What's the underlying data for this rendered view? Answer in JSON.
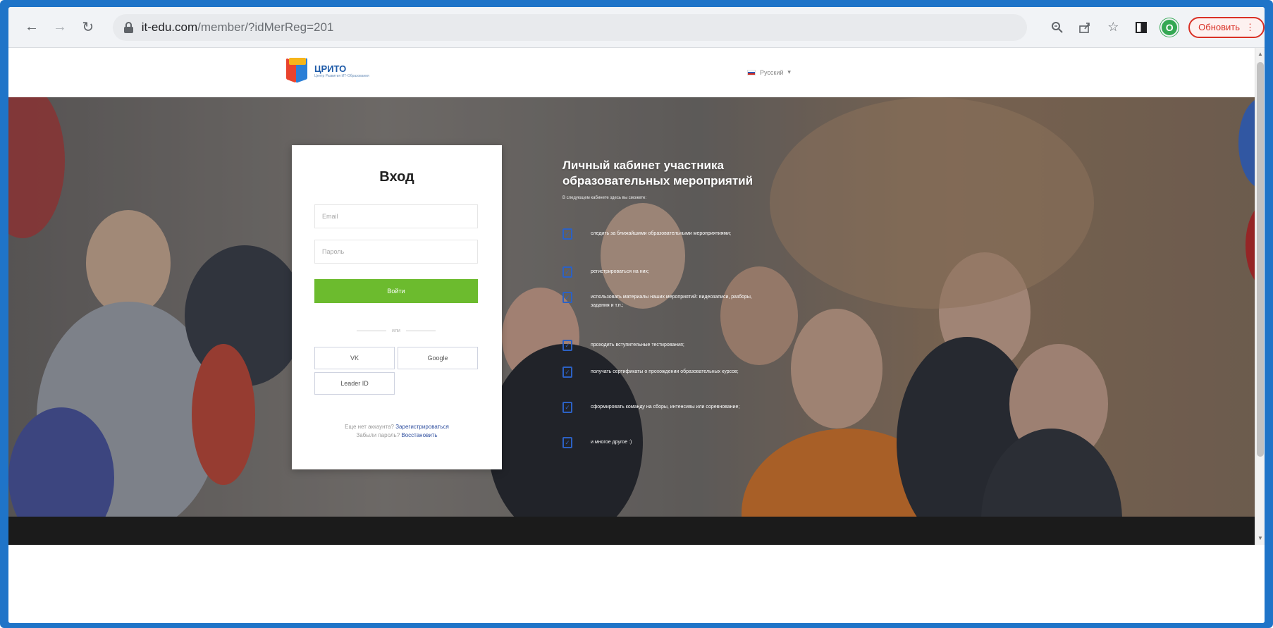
{
  "browser": {
    "url_host": "it-edu.com",
    "url_path": "/member/?idMerReg=201",
    "profile_initial": "O",
    "update_label": "Обновить",
    "update_menu_glyph": "⋮"
  },
  "site": {
    "logo_name": "ЦРИТО",
    "logo_sub": "Центр Развития ИТ-Образования",
    "language": "Русский",
    "language_caret": "▾"
  },
  "login": {
    "title": "Вход",
    "email_placeholder": "Email",
    "password_placeholder": "Пароль",
    "submit_label": "Войти",
    "divider_text": "или",
    "social_vk": "VK",
    "social_google": "Google",
    "social_leaderid": "Leader ID",
    "no_account_text": "Еще нет аккаунта?",
    "register_link": "Зарегистрироваться",
    "forgot_text": "Забыли пароль?",
    "restore_link": "Восстановить"
  },
  "info": {
    "title": "Личный кабинет участника образовательных мероприятий",
    "subtitle": "В следующем кабинете здесь вы сможете:",
    "benefits": [
      "следить за ближайшими образовательными мероприятиями;",
      "регистрироваться на них;",
      "использовать материалы наших мероприятий: видеозаписи, разборы, задания и т.п.;",
      "проходить вступительные тестирования;",
      "получать сертификаты о прохождении образовательных курсов;",
      "сформировать команду на сборы, интенсивы или соревнование;",
      "и многое другое :)"
    ]
  },
  "colors": {
    "frame": "#1f74c8",
    "primary_button": "#6cbb2e",
    "link": "#2f4f9f",
    "check": "#2c61c4"
  }
}
